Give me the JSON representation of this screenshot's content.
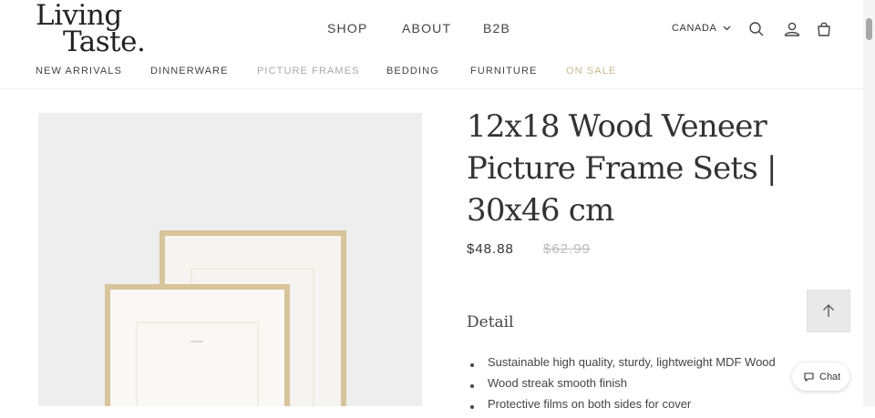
{
  "logo": {
    "line1": "Living",
    "line2": "Taste."
  },
  "main_nav": [
    {
      "label": "SHOP"
    },
    {
      "label": "ABOUT"
    },
    {
      "label": "B2B"
    }
  ],
  "header": {
    "country": "CANADA"
  },
  "icons": {
    "chevron": "chevron-down-icon",
    "search": "search-icon",
    "account": "account-icon",
    "cart": "cart-icon",
    "back_to_top": "arrow-up-icon",
    "chat": "chat-bubble-icon"
  },
  "category_nav": [
    {
      "label": "NEW ARRIVALS",
      "state": "default"
    },
    {
      "label": "DINNERWARE",
      "state": "default"
    },
    {
      "label": "PICTURE FRAMES",
      "state": "active"
    },
    {
      "label": "BEDDING",
      "state": "default"
    },
    {
      "label": "FURNITURE",
      "state": "default"
    },
    {
      "label": "ON SALE",
      "state": "sale"
    }
  ],
  "product": {
    "title": "12x18 Wood Veneer Picture Frame Sets | 30x46 cm",
    "price": "$48.88",
    "compare_price": "$62.99",
    "detail_heading": "Detail",
    "features": [
      "Sustainable high quality, sturdy, lightweight MDF Wood",
      "Wood streak smooth finish",
      "Protective films on both sides for cover"
    ]
  },
  "chat": {
    "label": "Chat"
  },
  "colors": {
    "text": "#333333",
    "muted_nav": "#a9a9a9",
    "sale_nav": "#c8b98f",
    "gallery_bg": "#eeeeee",
    "frame_wood": "#d8c49b"
  }
}
